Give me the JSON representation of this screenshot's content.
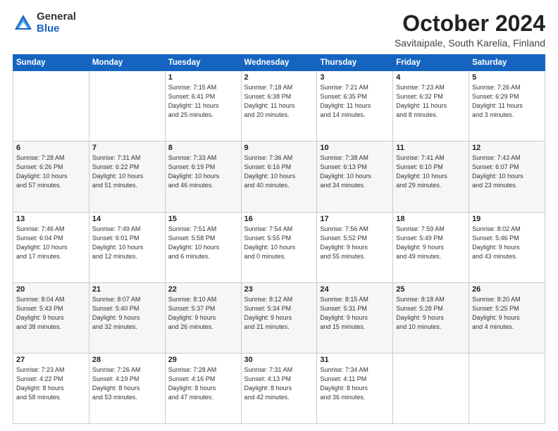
{
  "logo": {
    "general": "General",
    "blue": "Blue"
  },
  "title": {
    "month": "October 2024",
    "location": "Savitaipale, South Karelia, Finland"
  },
  "headers": [
    "Sunday",
    "Monday",
    "Tuesday",
    "Wednesday",
    "Thursday",
    "Friday",
    "Saturday"
  ],
  "weeks": [
    [
      {
        "day": "",
        "info": ""
      },
      {
        "day": "",
        "info": ""
      },
      {
        "day": "1",
        "info": "Sunrise: 7:15 AM\nSunset: 6:41 PM\nDaylight: 11 hours\nand 25 minutes."
      },
      {
        "day": "2",
        "info": "Sunrise: 7:18 AM\nSunset: 6:38 PM\nDaylight: 11 hours\nand 20 minutes."
      },
      {
        "day": "3",
        "info": "Sunrise: 7:21 AM\nSunset: 6:35 PM\nDaylight: 11 hours\nand 14 minutes."
      },
      {
        "day": "4",
        "info": "Sunrise: 7:23 AM\nSunset: 6:32 PM\nDaylight: 11 hours\nand 8 minutes."
      },
      {
        "day": "5",
        "info": "Sunrise: 7:26 AM\nSunset: 6:29 PM\nDaylight: 11 hours\nand 3 minutes."
      }
    ],
    [
      {
        "day": "6",
        "info": "Sunrise: 7:28 AM\nSunset: 6:26 PM\nDaylight: 10 hours\nand 57 minutes."
      },
      {
        "day": "7",
        "info": "Sunrise: 7:31 AM\nSunset: 6:22 PM\nDaylight: 10 hours\nand 51 minutes."
      },
      {
        "day": "8",
        "info": "Sunrise: 7:33 AM\nSunset: 6:19 PM\nDaylight: 10 hours\nand 46 minutes."
      },
      {
        "day": "9",
        "info": "Sunrise: 7:36 AM\nSunset: 6:16 PM\nDaylight: 10 hours\nand 40 minutes."
      },
      {
        "day": "10",
        "info": "Sunrise: 7:38 AM\nSunset: 6:13 PM\nDaylight: 10 hours\nand 34 minutes."
      },
      {
        "day": "11",
        "info": "Sunrise: 7:41 AM\nSunset: 6:10 PM\nDaylight: 10 hours\nand 29 minutes."
      },
      {
        "day": "12",
        "info": "Sunrise: 7:43 AM\nSunset: 6:07 PM\nDaylight: 10 hours\nand 23 minutes."
      }
    ],
    [
      {
        "day": "13",
        "info": "Sunrise: 7:46 AM\nSunset: 6:04 PM\nDaylight: 10 hours\nand 17 minutes."
      },
      {
        "day": "14",
        "info": "Sunrise: 7:49 AM\nSunset: 6:01 PM\nDaylight: 10 hours\nand 12 minutes."
      },
      {
        "day": "15",
        "info": "Sunrise: 7:51 AM\nSunset: 5:58 PM\nDaylight: 10 hours\nand 6 minutes."
      },
      {
        "day": "16",
        "info": "Sunrise: 7:54 AM\nSunset: 5:55 PM\nDaylight: 10 hours\nand 0 minutes."
      },
      {
        "day": "17",
        "info": "Sunrise: 7:56 AM\nSunset: 5:52 PM\nDaylight: 9 hours\nand 55 minutes."
      },
      {
        "day": "18",
        "info": "Sunrise: 7:59 AM\nSunset: 5:49 PM\nDaylight: 9 hours\nand 49 minutes."
      },
      {
        "day": "19",
        "info": "Sunrise: 8:02 AM\nSunset: 5:46 PM\nDaylight: 9 hours\nand 43 minutes."
      }
    ],
    [
      {
        "day": "20",
        "info": "Sunrise: 8:04 AM\nSunset: 5:43 PM\nDaylight: 9 hours\nand 38 minutes."
      },
      {
        "day": "21",
        "info": "Sunrise: 8:07 AM\nSunset: 5:40 PM\nDaylight: 9 hours\nand 32 minutes."
      },
      {
        "day": "22",
        "info": "Sunrise: 8:10 AM\nSunset: 5:37 PM\nDaylight: 9 hours\nand 26 minutes."
      },
      {
        "day": "23",
        "info": "Sunrise: 8:12 AM\nSunset: 5:34 PM\nDaylight: 9 hours\nand 21 minutes."
      },
      {
        "day": "24",
        "info": "Sunrise: 8:15 AM\nSunset: 5:31 PM\nDaylight: 9 hours\nand 15 minutes."
      },
      {
        "day": "25",
        "info": "Sunrise: 8:18 AM\nSunset: 5:28 PM\nDaylight: 9 hours\nand 10 minutes."
      },
      {
        "day": "26",
        "info": "Sunrise: 8:20 AM\nSunset: 5:25 PM\nDaylight: 9 hours\nand 4 minutes."
      }
    ],
    [
      {
        "day": "27",
        "info": "Sunrise: 7:23 AM\nSunset: 4:22 PM\nDaylight: 8 hours\nand 58 minutes."
      },
      {
        "day": "28",
        "info": "Sunrise: 7:26 AM\nSunset: 4:19 PM\nDaylight: 8 hours\nand 53 minutes."
      },
      {
        "day": "29",
        "info": "Sunrise: 7:28 AM\nSunset: 4:16 PM\nDaylight: 8 hours\nand 47 minutes."
      },
      {
        "day": "30",
        "info": "Sunrise: 7:31 AM\nSunset: 4:13 PM\nDaylight: 8 hours\nand 42 minutes."
      },
      {
        "day": "31",
        "info": "Sunrise: 7:34 AM\nSunset: 4:11 PM\nDaylight: 8 hours\nand 36 minutes."
      },
      {
        "day": "",
        "info": ""
      },
      {
        "day": "",
        "info": ""
      }
    ]
  ]
}
